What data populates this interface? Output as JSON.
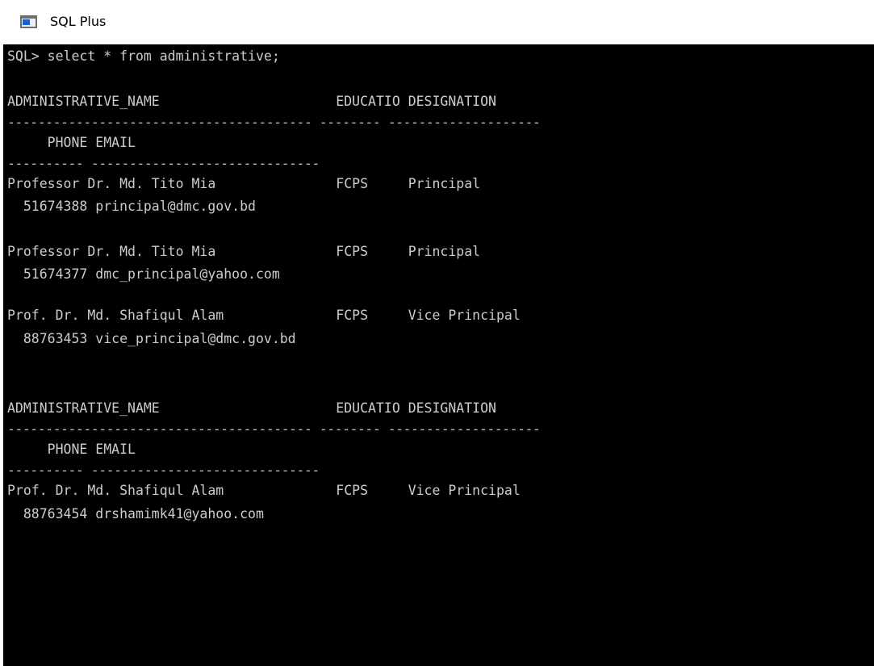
{
  "window": {
    "title": "SQL Plus"
  },
  "console": {
    "lines": [
      "SQL> select * from administrative;",
      "",
      "ADMINISTRATIVE_NAME                      EDUCATIO DESIGNATION",
      "---------------------------------------- -------- --------------------",
      "     PHONE EMAIL",
      "---------- ------------------------------",
      "Professor Dr. Md. Tito Mia               FCPS     Principal",
      "  51674388 principal@dmc.gov.bd",
      "",
      "Professor Dr. Md. Tito Mia               FCPS     Principal",
      "  51674377 dmc_principal@yahoo.com",
      "",
      "Prof. Dr. Md. Shafiqul Alam              FCPS     Vice Principal",
      "  88763453 vice_principal@dmc.gov.bd",
      "",
      "",
      "ADMINISTRATIVE_NAME                      EDUCATIO DESIGNATION",
      "---------------------------------------- -------- --------------------",
      "     PHONE EMAIL",
      "---------- ------------------------------",
      "Prof. Dr. Md. Shafiqul Alam              FCPS     Vice Principal",
      "  88763454 drshamimk41@yahoo.com"
    ]
  }
}
